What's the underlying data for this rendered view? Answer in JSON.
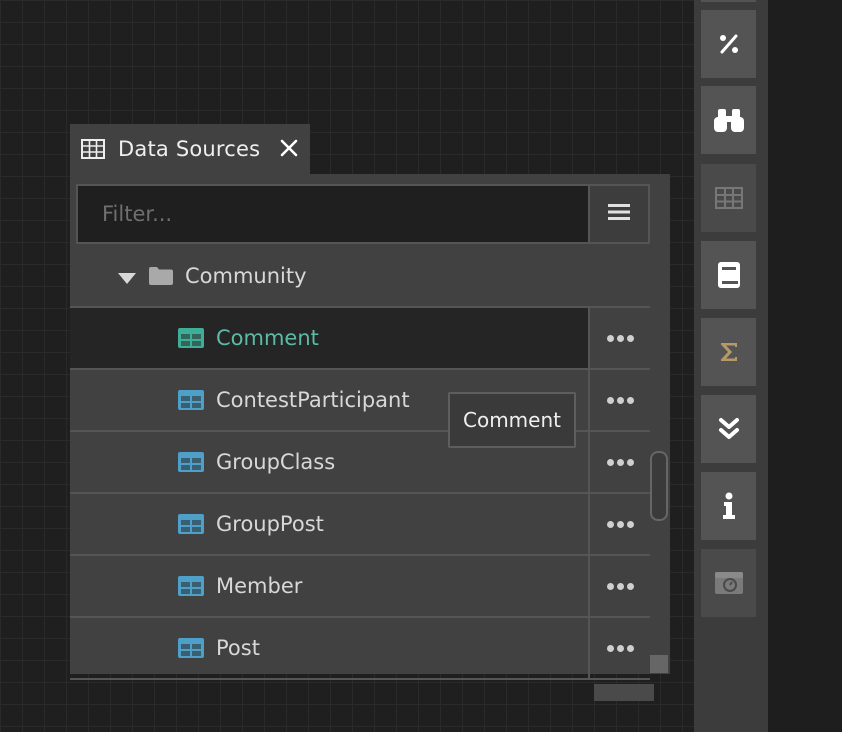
{
  "panel": {
    "title": "Data Sources",
    "filter_placeholder": "Filter...",
    "folder": {
      "label": "Community",
      "expanded": true
    },
    "items": [
      {
        "label": "Comment",
        "selected": true
      },
      {
        "label": "ContestParticipant",
        "selected": false
      },
      {
        "label": "GroupClass",
        "selected": false
      },
      {
        "label": "GroupPost",
        "selected": false
      },
      {
        "label": "Member",
        "selected": false
      },
      {
        "label": "Post",
        "selected": false
      }
    ],
    "tooltip": "Comment"
  },
  "toolbar": {
    "buttons": [
      {
        "icon": "percent-icon"
      },
      {
        "icon": "binoculars-icon"
      },
      {
        "icon": "table-icon",
        "dimmed": true
      },
      {
        "icon": "book-icon"
      },
      {
        "icon": "sigma-icon"
      },
      {
        "icon": "double-chevron-down-icon"
      },
      {
        "icon": "info-icon"
      },
      {
        "icon": "calendar-window-icon",
        "dimmed": true
      }
    ]
  },
  "colors": {
    "selected_text": "#5bbba7",
    "table_icon": "#4ea0c8",
    "selected_table_icon": "#3fae98",
    "sigma": "#b59a66"
  }
}
